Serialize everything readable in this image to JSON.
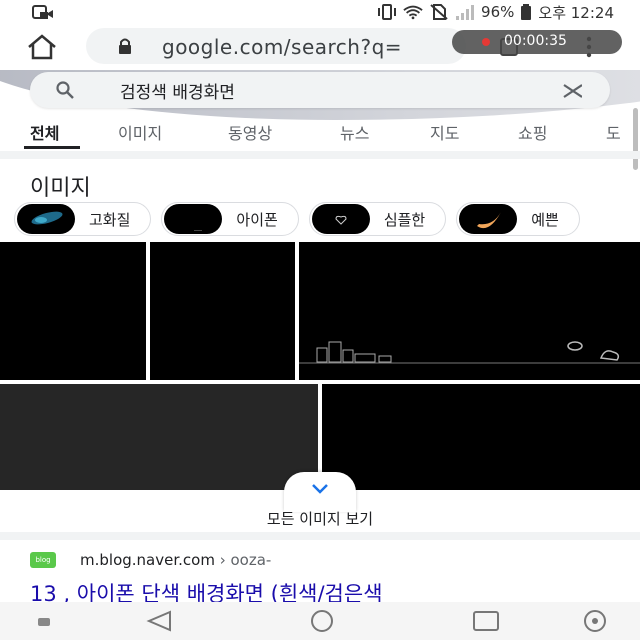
{
  "status_bar": {
    "battery": "96%",
    "time": "오후 12:24"
  },
  "browser": {
    "url": "google.com/search?q=",
    "recording_time": "00:00:35"
  },
  "search": {
    "query": "검정색 배경화면"
  },
  "tabs": [
    "전체",
    "이미지",
    "동영상",
    "뉴스",
    "지도",
    "쇼핑",
    "도"
  ],
  "images_section": {
    "title": "이미지",
    "chips": [
      "고화질",
      "아이폰",
      "심플한",
      "예쁜"
    ],
    "more_label": "모든 이미지 보기"
  },
  "result": {
    "favicon_text": "blog",
    "site": "m.blog.naver.com",
    "path": " › ooza-",
    "title": "13 , 아이폰 단색 배경화면 (흰색/검은색"
  },
  "colors": {
    "link": "#1a0dab",
    "record": "#e53935",
    "favicon": "#5ac84a"
  }
}
